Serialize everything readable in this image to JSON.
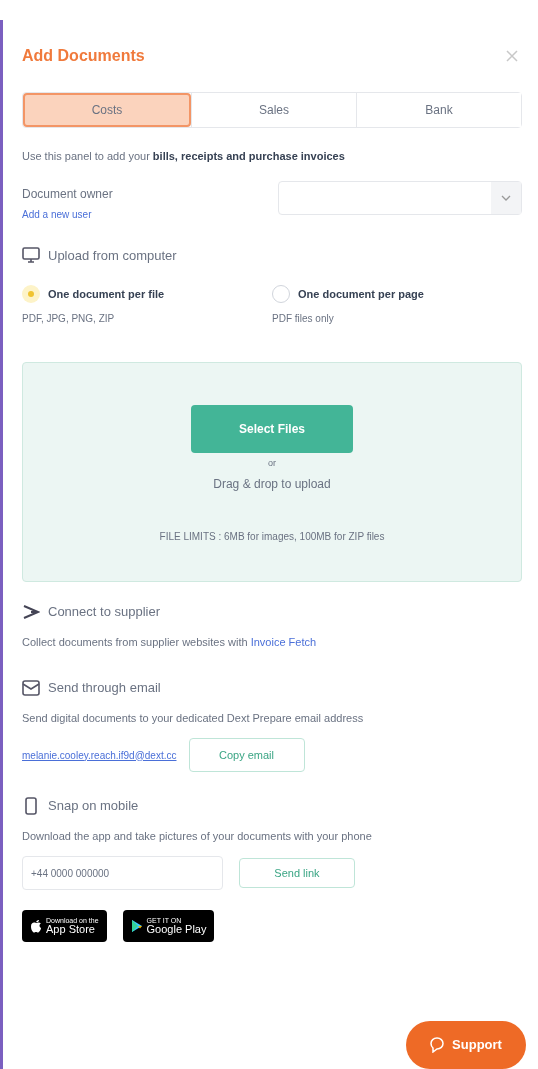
{
  "panel": {
    "title": "Add Documents"
  },
  "tabs": [
    {
      "label": "Costs",
      "selected": true
    },
    {
      "label": "Sales",
      "selected": false
    },
    {
      "label": "Bank",
      "selected": false
    }
  ],
  "intro": "Use this panel to add your **bills, receipts and purchase invoices**",
  "owner": {
    "label": "Document owner",
    "link": "Add a new user"
  },
  "upload": {
    "heading": "Upload from computer",
    "options": [
      {
        "label": "One document per file",
        "hint": "PDF, JPG, PNG, ZIP",
        "selected": true
      },
      {
        "label": "One document per page",
        "hint": "PDF files only",
        "selected": false
      }
    ],
    "button": "Select Files",
    "or": "or",
    "drop": "Drag & drop to upload",
    "limits": "FILE LIMITS : 6MB for images, 100MB for ZIP files"
  },
  "supplier": {
    "heading": "Connect to supplier",
    "text": "Collect documents from supplier websites with",
    "link": "Invoice Fetch"
  },
  "email": {
    "heading": "Send through email",
    "text": "Send digital documents to your dedicated Dext Prepare email address",
    "address": "melanie.cooley.reach.if9d@dext.cc",
    "button": "Copy email"
  },
  "mobile": {
    "heading": "Snap on mobile",
    "text": "Download the app and take pictures of your documents with your phone",
    "placeholder": "+44 0000 000000",
    "button": "Send link",
    "badges": [
      {
        "kind": "apple",
        "small": "Download on the",
        "big": "App Store"
      },
      {
        "kind": "google",
        "small": "GET IT ON",
        "big": "Google Play"
      }
    ]
  },
  "support": "Support"
}
